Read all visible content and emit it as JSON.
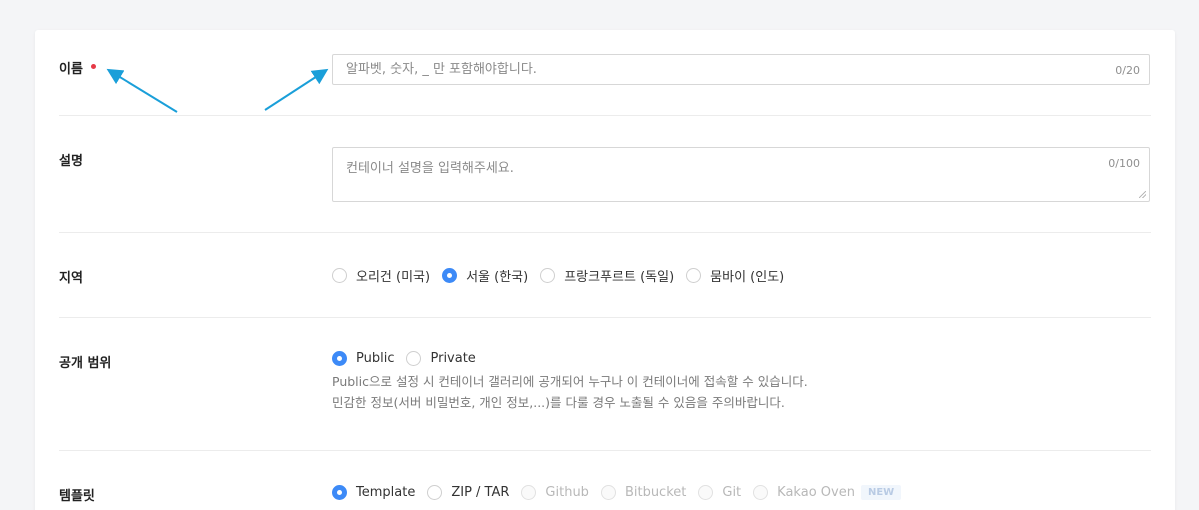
{
  "form": {
    "name": {
      "label": "이름",
      "placeholder": "알파벳, 숫자, _ 만 포함해야합니다.",
      "counter": "0/20"
    },
    "description": {
      "label": "설명",
      "placeholder": "컨테이너 설명을 입력해주세요.",
      "counter": "0/100"
    },
    "region": {
      "label": "지역",
      "options": [
        {
          "label": "오리건 (미국)",
          "checked": false
        },
        {
          "label": "서울 (한국)",
          "checked": true
        },
        {
          "label": "프랑크푸르트 (독일)",
          "checked": false
        },
        {
          "label": "뭄바이 (인도)",
          "checked": false
        }
      ]
    },
    "visibility": {
      "label": "공개 범위",
      "options": [
        {
          "label": "Public",
          "checked": true
        },
        {
          "label": "Private",
          "checked": false
        }
      ],
      "help_line1": "Public으로 설정 시 컨테이너 갤러리에 공개되어 누구나 이 컨테이너에 접속할 수 있습니다.",
      "help_line2": "민감한 정보(서버 비밀번호, 개인 정보,...)를 다룰 경우 노출될 수 있음을 주의바랍니다."
    },
    "template": {
      "label": "템플릿",
      "options": [
        {
          "label": "Template",
          "checked": true,
          "disabled": false
        },
        {
          "label": "ZIP / TAR",
          "checked": false,
          "disabled": false
        },
        {
          "label": "Github",
          "checked": false,
          "disabled": true
        },
        {
          "label": "Bitbucket",
          "checked": false,
          "disabled": true
        },
        {
          "label": "Git",
          "checked": false,
          "disabled": true
        },
        {
          "label": "Kakao Oven",
          "checked": false,
          "disabled": true
        }
      ],
      "new_badge": "NEW"
    }
  },
  "colors": {
    "accent": "#3d8af7",
    "required_dot": "#e63946",
    "annotation_arrow": "#1a9fd9"
  }
}
